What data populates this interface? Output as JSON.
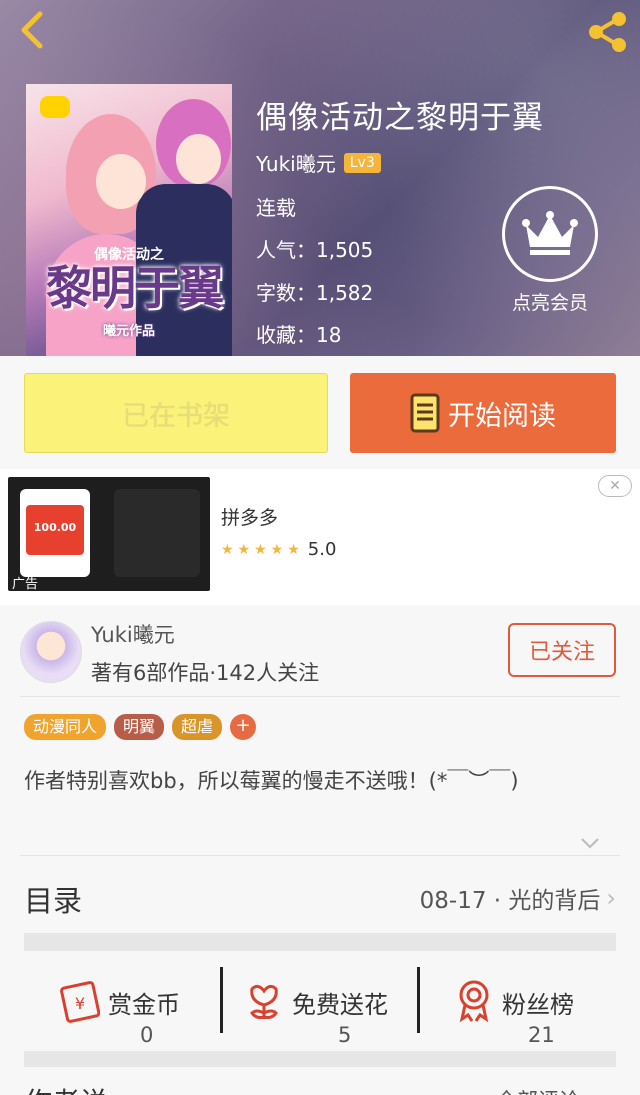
{
  "header": {
    "book_title": "偶像活动之黎明于翼",
    "author": "Yuki曦元",
    "level": "Lv3",
    "status": "连载",
    "popularity_label": "人气：",
    "popularity": "1,505",
    "words_label": "字数：",
    "words": "1,582",
    "favorites_label": "收藏：",
    "favorites": "18",
    "vip_label": "点亮会员",
    "cover": {
      "title": "黎明于翼",
      "subtitle": "偶像活动之",
      "author": "曦元作品"
    }
  },
  "actions": {
    "shelf_label": "已在书架",
    "read_label": "开始阅读"
  },
  "ad": {
    "title": "拼多多",
    "rating": "5.0",
    "tag": "广告",
    "amount": "100.00",
    "close": "✕"
  },
  "author_section": {
    "name": "Yuki曦元",
    "stats": "著有6部作品·142人关注",
    "follow_label": "已关注",
    "tags": [
      {
        "label": "动漫同人",
        "color": "#f0a42e"
      },
      {
        "label": "明翼",
        "color": "#b85d48"
      },
      {
        "label": "超虐",
        "color": "#d9952a"
      }
    ],
    "tag_add": "+",
    "description": "作者特别喜欢bb，所以莓翼的慢走不送哦！(*￣︶￣)"
  },
  "toc": {
    "title": "目录",
    "latest": "08-17 · 光的背后"
  },
  "stats": [
    {
      "label": "赏金币",
      "value": "0",
      "icon": "coin-envelope-icon"
    },
    {
      "label": "免费送花",
      "value": "5",
      "icon": "flower-icon"
    },
    {
      "label": "粉丝榜",
      "value": "21",
      "icon": "medal-icon"
    }
  ],
  "more": {
    "title": "作者说",
    "right": "全部评论"
  },
  "colors": {
    "accent": "#ec6b3c",
    "shelf": "#fbf27a",
    "icon_red": "#d9412e"
  }
}
